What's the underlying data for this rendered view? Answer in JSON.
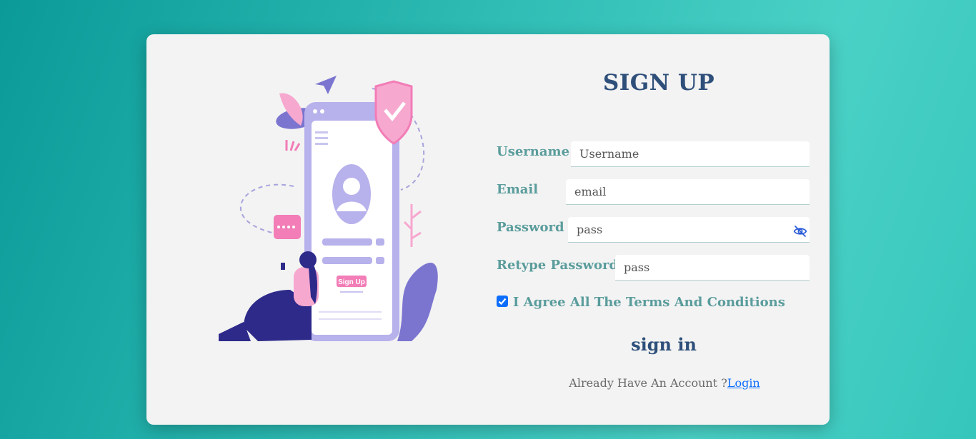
{
  "form": {
    "title": "SIGN UP",
    "username_label": "Username",
    "username_placeholder": "Username",
    "email_label": "Email",
    "email_placeholder": "email",
    "password_label": "Password",
    "password_placeholder": "pass",
    "retype_label": "Retype Password",
    "retype_placeholder": "pass",
    "terms_checked": true,
    "terms_label": "I Agree All The Terms And Conditions",
    "submit_label": "sign in",
    "already_text": "Already Have An Account ?",
    "login_link": "Login"
  },
  "illustration": {
    "button_text": "Sign Up",
    "icon": "sign-up-illustration"
  },
  "icons": {
    "password_toggle": "eye-slash-icon",
    "checkbox": "checkmark-icon"
  },
  "colors": {
    "title": "#2e4f7a",
    "label": "#5b9c9c",
    "link": "#0d6efd",
    "card": "#f3f3f3"
  }
}
